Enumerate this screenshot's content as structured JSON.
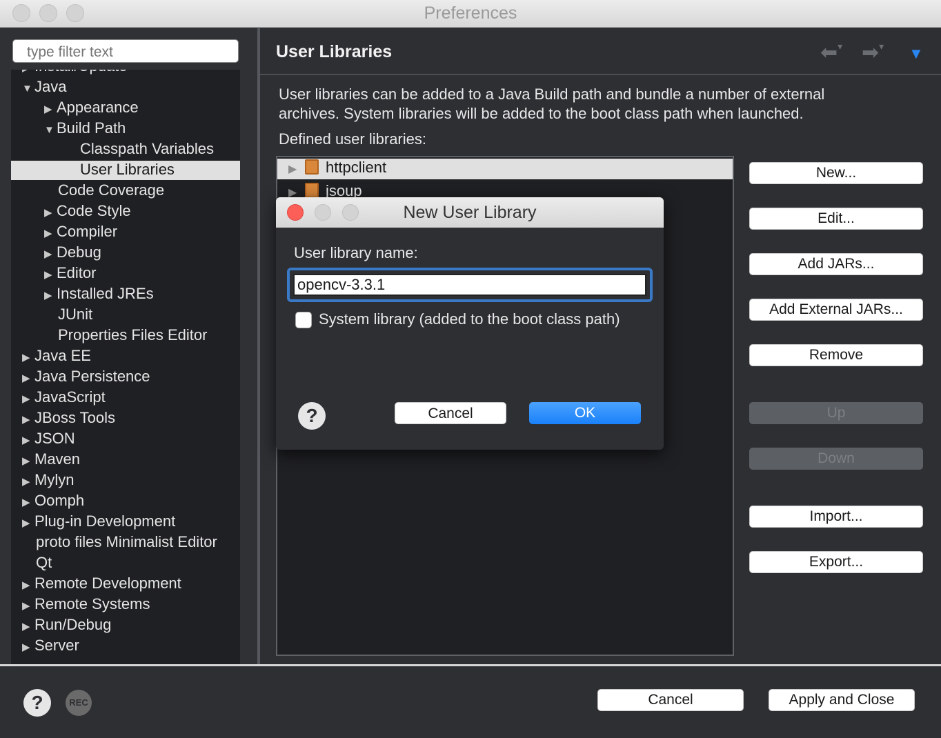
{
  "window": {
    "title": "Preferences"
  },
  "sidebar": {
    "filter_placeholder": "type filter text",
    "items": [
      {
        "label": "Install/Update",
        "arrow": "▶"
      },
      {
        "label": "Java",
        "arrow": "▼"
      },
      {
        "label": "Appearance",
        "arrow": "▶"
      },
      {
        "label": "Build Path",
        "arrow": "▼"
      },
      {
        "label": "Classpath Variables",
        "arrow": ""
      },
      {
        "label": "User Libraries",
        "arrow": ""
      },
      {
        "label": "Code Coverage",
        "arrow": ""
      },
      {
        "label": "Code Style",
        "arrow": "▶"
      },
      {
        "label": "Compiler",
        "arrow": "▶"
      },
      {
        "label": "Debug",
        "arrow": "▶"
      },
      {
        "label": "Editor",
        "arrow": "▶"
      },
      {
        "label": "Installed JREs",
        "arrow": "▶"
      },
      {
        "label": "JUnit",
        "arrow": ""
      },
      {
        "label": "Properties Files Editor",
        "arrow": ""
      },
      {
        "label": "Java EE",
        "arrow": "▶"
      },
      {
        "label": "Java Persistence",
        "arrow": "▶"
      },
      {
        "label": "JavaScript",
        "arrow": "▶"
      },
      {
        "label": "JBoss Tools",
        "arrow": "▶"
      },
      {
        "label": "JSON",
        "arrow": "▶"
      },
      {
        "label": "Maven",
        "arrow": "▶"
      },
      {
        "label": "Mylyn",
        "arrow": "▶"
      },
      {
        "label": "Oomph",
        "arrow": "▶"
      },
      {
        "label": "Plug-in Development",
        "arrow": "▶"
      },
      {
        "label": "proto files Minimalist Editor",
        "arrow": ""
      },
      {
        "label": "Qt",
        "arrow": ""
      },
      {
        "label": "Remote Development",
        "arrow": "▶"
      },
      {
        "label": "Remote Systems",
        "arrow": "▶"
      },
      {
        "label": "Run/Debug",
        "arrow": "▶"
      },
      {
        "label": "Server",
        "arrow": "▶"
      }
    ]
  },
  "page": {
    "title": "User Libraries",
    "description": "User libraries can be added to a Java Build path and bundle a number of external archives. System libraries will be added to the boot class path when launched.",
    "defined_label": "Defined user libraries:",
    "libraries": [
      {
        "name": "httpclient",
        "icon": "library-book-icon"
      },
      {
        "name": "jsoup",
        "icon": "library-book-icon"
      }
    ],
    "buttons": {
      "new": "New...",
      "edit": "Edit...",
      "add_jars": "Add JARs...",
      "add_external_jars": "Add External JARs...",
      "remove": "Remove",
      "up": "Up",
      "down": "Down",
      "import": "Import...",
      "export": "Export..."
    }
  },
  "footer": {
    "cancel": "Cancel",
    "apply_close": "Apply and Close",
    "help": "?",
    "rec": "REC"
  },
  "dialog": {
    "title": "New User Library",
    "name_label": "User library name:",
    "name_value": "opencv-3.3.1",
    "system_library_label": "System library (added to the boot class path)",
    "system_library_checked": false,
    "help": "?",
    "cancel": "Cancel",
    "ok": "OK"
  },
  "colors": {
    "accent": "#1a82fb",
    "selection": "#e0e0e0",
    "panel": "#2d2f33",
    "tree_bg": "#1f2023"
  }
}
